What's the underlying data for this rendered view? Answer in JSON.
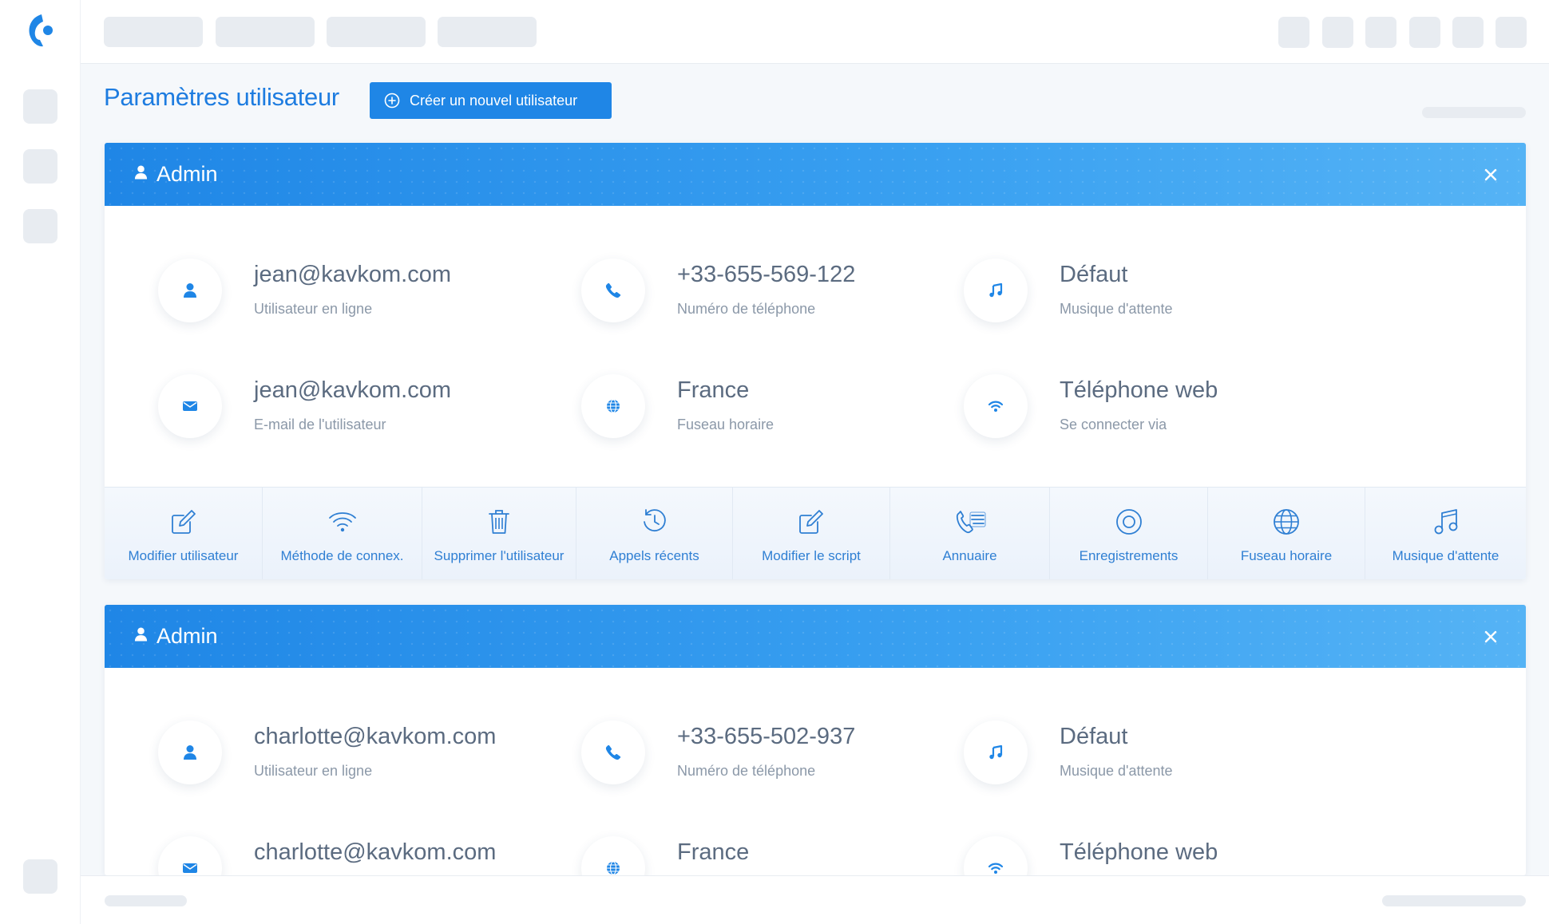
{
  "page": {
    "title": "Paramètres utilisateur",
    "create_button_label": "Créer un nouvel utilisateur"
  },
  "colors": {
    "accent": "#1f86e6",
    "title": "#1d7ce0",
    "placeholder": "#e8ecf1"
  },
  "users": [
    {
      "role": "Admin",
      "fields": {
        "online_user": {
          "value": "jean@kavkom.com",
          "label": "Utilisateur en ligne",
          "icon": "user-icon"
        },
        "phone": {
          "value": "+33-655-569-122",
          "label": "Numéro de téléphone",
          "icon": "phone-icon"
        },
        "hold_music": {
          "value": "Défaut",
          "label": "Musique d'attente",
          "icon": "music-note-icon"
        },
        "email": {
          "value": "jean@kavkom.com",
          "label": "E-mail de l'utilisateur",
          "icon": "mail-icon"
        },
        "timezone": {
          "value": "France",
          "label": "Fuseau horaire",
          "icon": "globe-icon"
        },
        "connect_via": {
          "value": "Téléphone web",
          "label": "Se connecter via",
          "icon": "wifi-icon"
        }
      }
    },
    {
      "role": "Admin",
      "fields": {
        "online_user": {
          "value": "charlotte@kavkom.com",
          "label": "Utilisateur en ligne",
          "icon": "user-icon"
        },
        "phone": {
          "value": "+33-655-502-937",
          "label": "Numéro de téléphone",
          "icon": "phone-icon"
        },
        "hold_music": {
          "value": "Défaut",
          "label": "Musique d'attente",
          "icon": "music-note-icon"
        },
        "email": {
          "value": "charlotte@kavkom.com",
          "label": "",
          "icon": "mail-icon"
        },
        "timezone": {
          "value": "France",
          "label": "",
          "icon": "globe-icon"
        },
        "connect_via": {
          "value": "Téléphone web",
          "label": "",
          "icon": "wifi-icon"
        }
      }
    }
  ],
  "actions": [
    {
      "label": "Modifier utilisateur",
      "icon": "edit-icon"
    },
    {
      "label": "Méthode de connex.",
      "icon": "wifi-icon"
    },
    {
      "label": "Supprimer l'utilisateur",
      "icon": "trash-icon"
    },
    {
      "label": "Appels récents",
      "icon": "history-icon"
    },
    {
      "label": "Modifier le script",
      "icon": "edit-icon"
    },
    {
      "label": "Annuaire",
      "icon": "phonebook-icon"
    },
    {
      "label": "Enregistrements",
      "icon": "record-icon"
    },
    {
      "label": "Fuseau horaire",
      "icon": "globe-icon"
    },
    {
      "label": "Musique d'attente",
      "icon": "music-note-icon"
    }
  ]
}
